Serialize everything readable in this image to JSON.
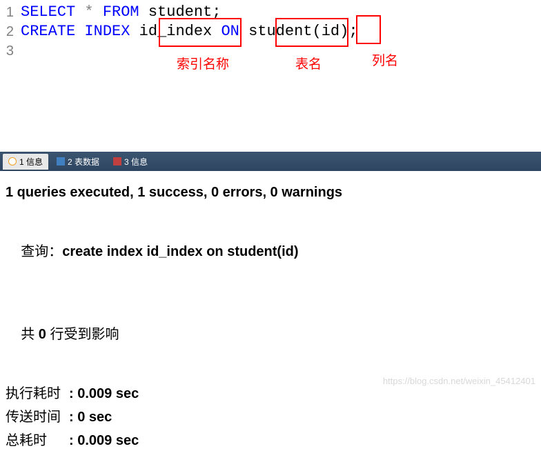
{
  "code": {
    "line1": {
      "num": "1",
      "kw1": "SELECT",
      "sym1": "*",
      "kw2": "FROM",
      "ident1": "student",
      "term": ";"
    },
    "line2": {
      "num": "2",
      "kw1": "CREATE",
      "kw2": "INDEX",
      "ident1": "id_index",
      "kw3": "ON",
      "ident2": "student",
      "open": "(",
      "ident3": "id",
      "close": ")",
      "term": ";"
    },
    "line3": {
      "num": "3"
    }
  },
  "annotations": {
    "label1": "索引名称",
    "label2": "表名",
    "label3": "列名"
  },
  "tabs": [
    {
      "label": "1 信息",
      "icon": "info-icon"
    },
    {
      "label": "2 表数据",
      "icon": "table-icon"
    },
    {
      "label": "3 信息",
      "icon": "bar-icon"
    }
  ],
  "results": {
    "summary": "1 queries executed, 1 success, 0 errors, 0 warnings",
    "query_label": "查询：",
    "query_text": "create index id_index on student(id)",
    "affected_prefix": "共 ",
    "affected_count": "0",
    "affected_suffix": " 行受到影响",
    "timing": [
      {
        "label": "执行耗时",
        "value": ": 0.009 sec"
      },
      {
        "label": "传送时间",
        "value": ": 0 sec"
      },
      {
        "label": "总耗时",
        "value": ": 0.009 sec"
      }
    ]
  },
  "watermark": "https://blog.csdn.net/weixin_45412401"
}
